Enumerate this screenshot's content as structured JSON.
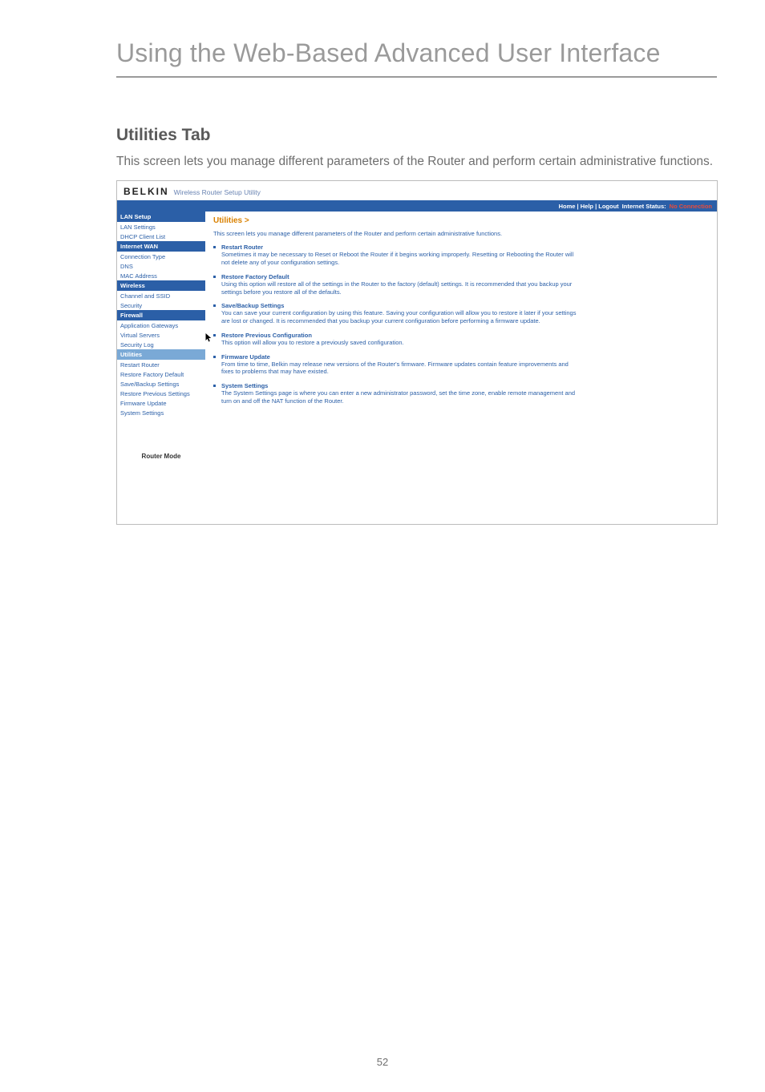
{
  "page": {
    "title": "Using the Web-Based Advanced User Interface",
    "number": "52"
  },
  "section": {
    "heading": "Utilities Tab",
    "desc": "This screen lets you manage different parameters of the Router and perform certain administrative functions."
  },
  "shot": {
    "brand": "BELKIN",
    "brand_sub": "Wireless Router Setup Utility",
    "topbar": {
      "links": "Home | Help | Logout",
      "status_label": "Internet Status:",
      "status_value": "No Connection"
    },
    "nav": {
      "groups": [
        {
          "head": "LAN Setup",
          "items": [
            "LAN Settings",
            "DHCP Client List"
          ]
        },
        {
          "head": "Internet WAN",
          "items": [
            "Connection Type",
            "DNS",
            "MAC Address"
          ]
        },
        {
          "head": "Wireless",
          "items": [
            "Channel and SSID",
            "Security"
          ]
        },
        {
          "head": "Firewall",
          "items": [
            "Application Gateways",
            "Virtual Servers",
            "Security Log"
          ]
        },
        {
          "head": "Utilities",
          "items": [
            "Restart Router",
            "Restore Factory Default",
            "Save/Backup Settings",
            "Restore Previous Settings",
            "Firmware Update",
            "System Settings"
          ],
          "active_head": true
        }
      ],
      "footer": "Router Mode"
    },
    "main": {
      "title": "Utilities >",
      "intro": "This screen lets you manage different parameters of the Router and perform certain administrative functions.",
      "items": [
        {
          "link": "Restart Router",
          "desc": "Sometimes it may be necessary to Reset or Reboot the Router if it begins working improperly. Resetting or Rebooting the Router will not delete any of your configuration settings."
        },
        {
          "link": "Restore Factory Default",
          "desc": "Using this option will restore all of the settings in the Router to the factory (default) settings. It is recommended that you backup your settings before you restore all of the defaults."
        },
        {
          "link": "Save/Backup Settings",
          "desc": "You can save your current configuration by using this feature. Saving your configuration will allow you to restore it later if your settings are lost or changed. It is recommended that you backup your current configuration before performing a firmware update."
        },
        {
          "link": "Restore Previous Configuration",
          "desc": "This option will allow you to restore a previously saved configuration."
        },
        {
          "link": "Firmware Update",
          "desc": "From time to time, Belkin may release new versions of the Router's firmware. Firmware updates contain feature improvements and fixes to problems that may have existed."
        },
        {
          "link": "System Settings",
          "desc": "The System Settings page is where you can enter a new administrator password, set the time zone, enable remote management and turn on and off the NAT function of the Router."
        }
      ]
    }
  }
}
